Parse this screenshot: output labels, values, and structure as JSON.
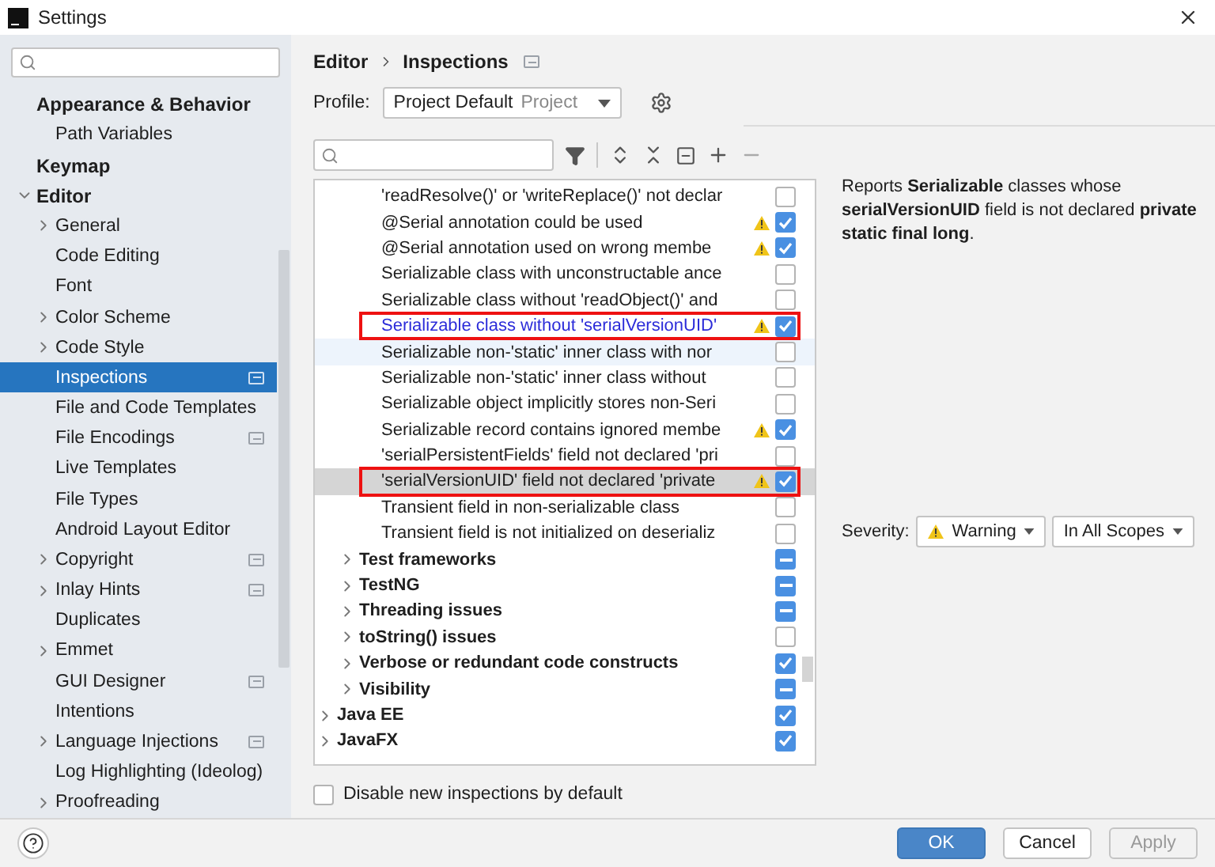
{
  "window": {
    "title": "Settings"
  },
  "sidebar": {
    "items": [
      {
        "label": "Appearance & Behavior",
        "selected": false,
        "children": [
          {
            "label": "Path Variables",
            "selected": false
          }
        ]
      },
      {
        "label": "Keymap",
        "selected": false
      },
      {
        "label": "Editor",
        "selected": false,
        "expanded": true,
        "children": [
          {
            "label": "General",
            "selected": false,
            "expanded": false
          },
          {
            "label": "Code Editing",
            "selected": false
          },
          {
            "label": "Font",
            "selected": false
          },
          {
            "label": "Color Scheme",
            "selected": false,
            "expanded": false
          },
          {
            "label": "Code Style",
            "selected": false,
            "expanded": false
          },
          {
            "label": "Inspections",
            "selected": true,
            "project_level": true
          },
          {
            "label": "File and Code Templates",
            "selected": false
          },
          {
            "label": "File Encodings",
            "selected": false,
            "project_level": true
          },
          {
            "label": "Live Templates",
            "selected": false
          },
          {
            "label": "File Types",
            "selected": false
          },
          {
            "label": "Android Layout Editor",
            "selected": false
          },
          {
            "label": "Copyright",
            "selected": false,
            "expanded": false,
            "project_level": true
          },
          {
            "label": "Inlay Hints",
            "selected": false,
            "expanded": false,
            "project_level": true
          },
          {
            "label": "Duplicates",
            "selected": false
          },
          {
            "label": "Emmet",
            "selected": false,
            "expanded": false
          },
          {
            "label": "GUI Designer",
            "selected": false,
            "project_level": true
          },
          {
            "label": "Intentions",
            "selected": false
          },
          {
            "label": "Language Injections",
            "selected": false,
            "expanded": false,
            "project_level": true
          },
          {
            "label": "Log Highlighting (Ideolog)",
            "selected": false
          },
          {
            "label": "Proofreading",
            "selected": false,
            "expanded": false
          }
        ]
      }
    ]
  },
  "breadcrumb": {
    "items": [
      "Editor",
      "Inspections"
    ]
  },
  "profile": {
    "label": "Profile:",
    "value": "Project Default",
    "scope": "Project"
  },
  "tree": [
    {
      "children": [
        {
          "children": [
            {
              "label": "'readResolve()' or 'writeReplace()' not declar",
              "checked": false,
              "warning": false,
              "selected": false,
              "highlighted": false
            },
            {
              "label": "@Serial annotation could be used",
              "checked": true,
              "warning": true,
              "selected": false,
              "highlighted": false
            },
            {
              "label": "@Serial annotation used on wrong membe",
              "checked": true,
              "warning": true,
              "selected": false,
              "highlighted": false
            },
            {
              "label": "Serializable class with unconstructable ance",
              "checked": false,
              "warning": false,
              "selected": false,
              "highlighted": false
            },
            {
              "label": "Serializable class without 'readObject()' and",
              "checked": false,
              "warning": false,
              "selected": false,
              "highlighted": false
            },
            {
              "label": "Serializable class without 'serialVersionUID'",
              "checked": true,
              "warning": true,
              "selected": false,
              "highlighted": true,
              "modified": true
            },
            {
              "label": "Serializable non-'static' inner class with nor",
              "checked": false,
              "warning": false,
              "selected": false,
              "highlighted": false,
              "hovered": true
            },
            {
              "label": "Serializable non-'static' inner class without",
              "checked": false,
              "warning": false,
              "selected": false,
              "highlighted": false
            },
            {
              "label": "Serializable object implicitly stores non-Seri",
              "checked": false,
              "warning": false,
              "selected": false,
              "highlighted": false
            },
            {
              "label": "Serializable record contains ignored membe",
              "checked": true,
              "warning": true,
              "selected": false,
              "highlighted": false
            },
            {
              "label": "'serialPersistentFields' field not declared 'pri",
              "checked": false,
              "warning": false,
              "selected": false,
              "highlighted": false
            },
            {
              "label": "'serialVersionUID' field not declared 'private",
              "checked": true,
              "warning": true,
              "selected": true,
              "highlighted": true
            },
            {
              "label": "Transient field in non-serializable class",
              "checked": false,
              "warning": false,
              "selected": false,
              "highlighted": false
            },
            {
              "label": "Transient field is not initialized on deserializ",
              "checked": false,
              "warning": false,
              "selected": false,
              "highlighted": false
            }
          ]
        },
        {
          "label": "Test frameworks",
          "partial": true,
          "expanded": false,
          "selected": false,
          "highlighted": false
        },
        {
          "label": "TestNG",
          "partial": true,
          "expanded": false,
          "selected": false,
          "highlighted": false
        },
        {
          "label": "Threading issues",
          "partial": true,
          "expanded": false,
          "selected": false,
          "highlighted": false
        },
        {
          "label": "toString() issues",
          "checked": false,
          "partial": false,
          "expanded": false,
          "selected": false,
          "highlighted": false
        },
        {
          "label": "Verbose or redundant code constructs",
          "checked": true,
          "expanded": false,
          "selected": false,
          "highlighted": false
        },
        {
          "label": "Visibility",
          "partial": true,
          "expanded": false,
          "selected": false,
          "highlighted": false
        }
      ]
    },
    {
      "label": "Java EE",
      "checked": true,
      "expanded": false,
      "selected": false,
      "highlighted": false
    },
    {
      "label": "JavaFX",
      "checked": true,
      "expanded": false,
      "selected": false,
      "highlighted": false
    }
  ],
  "disable_new": {
    "label": "Disable new inspections by default",
    "checked": false
  },
  "details": {
    "description": "Reports **Serializable** classes whose **serialVersionUID** field is not declared **private static final long**.",
    "severity_label": "Severity:",
    "severity": "Warning",
    "scope": "In All Scopes"
  },
  "buttons": [
    {
      "label": "OK",
      "kind": "primary"
    },
    {
      "label": "Cancel",
      "kind": "default"
    },
    {
      "label": "Apply",
      "kind": "disabled"
    }
  ]
}
